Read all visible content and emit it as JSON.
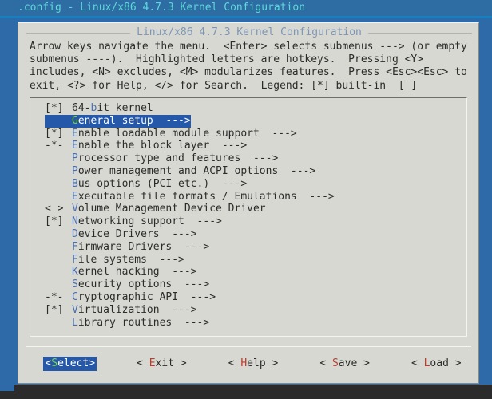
{
  "window": {
    "titlebar": ".config - Linux/x86 4.7.3 Kernel Configuration"
  },
  "dialog": {
    "title": "Linux/x86 4.7.3 Kernel Configuration",
    "help_lines": [
      "Arrow keys navigate the menu.  <Enter> selects submenus ---> (or empty",
      "submenus ----).  Highlighted letters are hotkeys.  Pressing <Y>",
      "includes, <N> excludes, <M> modularizes features.  Press <Esc><Esc> to",
      "exit, <?> for Help, </> for Search.  Legend: [*] built-in  [ ]"
    ]
  },
  "menu": {
    "items": [
      {
        "marker": "[*]",
        "hot_pre": "64-",
        "hot": "b",
        "rest": "it kernel",
        "arrow": "",
        "selected": false
      },
      {
        "marker": "   ",
        "hot_pre": "",
        "hot": "G",
        "rest": "eneral setup",
        "arrow": "  --->",
        "selected": true
      },
      {
        "marker": "[*]",
        "hot_pre": "",
        "hot": "E",
        "rest": "nable loadable module support",
        "arrow": "  --->",
        "selected": false
      },
      {
        "marker": "-*-",
        "hot_pre": "",
        "hot": "E",
        "rest": "nable the block layer",
        "arrow": "  --->",
        "selected": false
      },
      {
        "marker": "   ",
        "hot_pre": "",
        "hot": "P",
        "rest": "rocessor type and features",
        "arrow": "  --->",
        "selected": false
      },
      {
        "marker": "   ",
        "hot_pre": "",
        "hot": "P",
        "rest": "ower management and ACPI options",
        "arrow": "  --->",
        "selected": false
      },
      {
        "marker": "   ",
        "hot_pre": "",
        "hot": "B",
        "rest": "us options (PCI etc.)",
        "arrow": "  --->",
        "selected": false
      },
      {
        "marker": "   ",
        "hot_pre": "",
        "hot": "E",
        "rest": "xecutable file formats / Emulations",
        "arrow": "  --->",
        "selected": false
      },
      {
        "marker": "< >",
        "hot_pre": "",
        "hot": "V",
        "rest": "olume Management Device Driver",
        "arrow": "",
        "selected": false
      },
      {
        "marker": "[*]",
        "hot_pre": "",
        "hot": "N",
        "rest": "etworking support",
        "arrow": "  --->",
        "selected": false
      },
      {
        "marker": "   ",
        "hot_pre": "",
        "hot": "D",
        "rest": "evice Drivers",
        "arrow": "  --->",
        "selected": false
      },
      {
        "marker": "   ",
        "hot_pre": "",
        "hot": "F",
        "rest": "irmware Drivers",
        "arrow": "  --->",
        "selected": false
      },
      {
        "marker": "   ",
        "hot_pre": "",
        "hot": "F",
        "rest": "ile systems",
        "arrow": "  --->",
        "selected": false
      },
      {
        "marker": "   ",
        "hot_pre": "",
        "hot": "K",
        "rest": "ernel hacking",
        "arrow": "  --->",
        "selected": false
      },
      {
        "marker": "   ",
        "hot_pre": "",
        "hot": "S",
        "rest": "ecurity options",
        "arrow": "  --->",
        "selected": false
      },
      {
        "marker": "-*-",
        "hot_pre": "",
        "hot": "C",
        "rest": "ryptographic API",
        "arrow": "  --->",
        "selected": false
      },
      {
        "marker": "[*]",
        "hot_pre": "",
        "hot": "V",
        "rest": "irtualization",
        "arrow": "  --->",
        "selected": false
      },
      {
        "marker": "   ",
        "hot_pre": "",
        "hot": "L",
        "rest": "ibrary routines",
        "arrow": "  --->",
        "selected": false
      }
    ]
  },
  "buttons": [
    {
      "pre": "<",
      "hot": "S",
      "post": "elect>",
      "label": "<Select>",
      "active": true
    },
    {
      "pre": "< ",
      "hot": "E",
      "post": "xit >",
      "label": "< Exit >",
      "active": false
    },
    {
      "pre": "< ",
      "hot": "H",
      "post": "elp >",
      "label": "< Help >",
      "active": false
    },
    {
      "pre": "< ",
      "hot": "S",
      "post": "ave >",
      "label": "< Save >",
      "active": false
    },
    {
      "pre": "< ",
      "hot": "L",
      "post": "oad >",
      "label": "< Load >",
      "active": false
    }
  ],
  "colors": {
    "desktop_blue": "#2f6aa8",
    "titlebar_bg": "#2e6ca4",
    "titlebar_fg": "#5fd8d8",
    "panel_bg": "#d8d8d2",
    "dialog_title_fg": "#7d95b4",
    "hotkey_fg": "#4a6fae",
    "selection_bg": "#2558a8",
    "selection_hotkey_fg": "#7ad63f",
    "button_hotkey_fg": "#c0392b",
    "terminal_bg": "#2b2b2b"
  }
}
